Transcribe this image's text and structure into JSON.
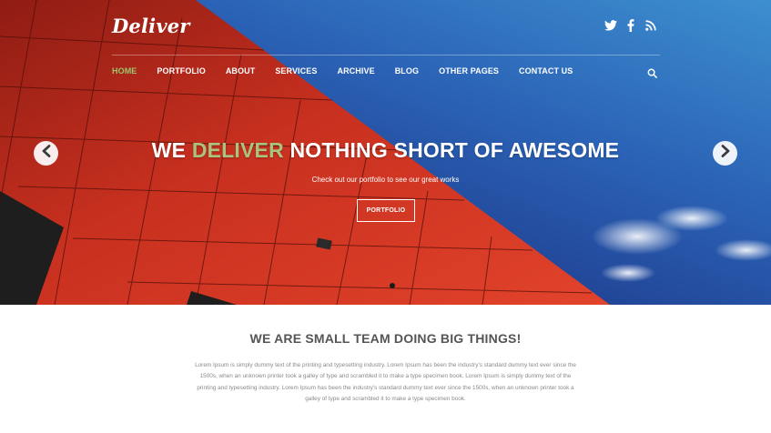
{
  "brand": {
    "logo": "Deliver"
  },
  "social": [
    {
      "name": "twitter-icon"
    },
    {
      "name": "facebook-icon"
    },
    {
      "name": "rss-icon"
    }
  ],
  "nav": {
    "items": [
      {
        "label": "HOME",
        "active": true
      },
      {
        "label": "PORTFOLIO",
        "active": false
      },
      {
        "label": "ABOUT",
        "active": false
      },
      {
        "label": "SERVICES",
        "active": false
      },
      {
        "label": "ARCHIVE",
        "active": false
      },
      {
        "label": "BLOG",
        "active": false
      },
      {
        "label": "OTHER PAGES",
        "active": false
      },
      {
        "label": "CONTACT US",
        "active": false
      }
    ],
    "search_icon": "search-icon"
  },
  "hero": {
    "headline_pre": "WE ",
    "headline_accent": "DELIVER",
    "headline_post": " NOTHING SHORT OF AWESOME",
    "subline": "Check out our portfolio to see our great works",
    "cta_label": "PORTFOLIO",
    "prev_icon": "chevron-left-icon",
    "next_icon": "chevron-right-icon"
  },
  "about": {
    "title": "WE ARE SMALL TEAM DOING BIG THINGS!",
    "body": "Lorem Ipsum is simply dummy text of the printing and typesetting industry. Lorem Ipsum has been the industry's standard dummy text ever since the 1500s, when an unknown printer took a galley of type and scrambled it to make a type specimen book. Lorem Ipsum is simply dummy text of the printing and typesetting industry. Lorem Ipsum has been the industry's standard dummy text ever since the 1500s, when an unknown printer took a galley of type and scrambled it to make a type specimen book."
  },
  "colors": {
    "accent_green": "#9cc56b",
    "sky_blue": "#2b63b6",
    "building_red": "#d83a26",
    "heading_gray": "#555555",
    "body_gray": "#8a8a8a"
  }
}
